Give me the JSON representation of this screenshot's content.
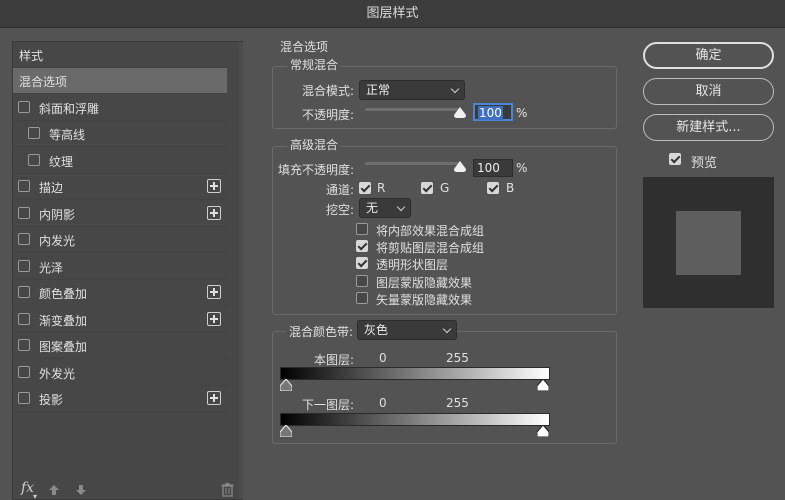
{
  "title": "图层样式",
  "sidebar": {
    "header": "样式",
    "items": [
      {
        "label": "混合选项",
        "checkbox": false,
        "checked": false,
        "selected": true,
        "indent": false,
        "plus": false
      },
      {
        "label": "斜面和浮雕",
        "checkbox": true,
        "checked": false,
        "selected": false,
        "indent": false,
        "plus": false
      },
      {
        "label": "等高线",
        "checkbox": true,
        "checked": false,
        "selected": false,
        "indent": true,
        "plus": false
      },
      {
        "label": "纹理",
        "checkbox": true,
        "checked": false,
        "selected": false,
        "indent": true,
        "plus": false
      },
      {
        "label": "描边",
        "checkbox": true,
        "checked": false,
        "selected": false,
        "indent": false,
        "plus": true
      },
      {
        "label": "内阴影",
        "checkbox": true,
        "checked": false,
        "selected": false,
        "indent": false,
        "plus": true
      },
      {
        "label": "内发光",
        "checkbox": true,
        "checked": false,
        "selected": false,
        "indent": false,
        "plus": false
      },
      {
        "label": "光泽",
        "checkbox": true,
        "checked": false,
        "selected": false,
        "indent": false,
        "plus": false
      },
      {
        "label": "颜色叠加",
        "checkbox": true,
        "checked": false,
        "selected": false,
        "indent": false,
        "plus": true
      },
      {
        "label": "渐变叠加",
        "checkbox": true,
        "checked": false,
        "selected": false,
        "indent": false,
        "plus": true
      },
      {
        "label": "图案叠加",
        "checkbox": true,
        "checked": false,
        "selected": false,
        "indent": false,
        "plus": false
      },
      {
        "label": "外发光",
        "checkbox": true,
        "checked": false,
        "selected": false,
        "indent": false,
        "plus": false
      },
      {
        "label": "投影",
        "checkbox": true,
        "checked": false,
        "selected": false,
        "indent": false,
        "plus": true
      }
    ],
    "footer_fx": "fx"
  },
  "blend": {
    "section_title": "混合选项",
    "general": {
      "title": "常规混合",
      "mode_label": "混合模式:",
      "mode_value": "正常",
      "opacity_label": "不透明度:",
      "opacity_value": "100",
      "opacity_unit": "%"
    },
    "advanced": {
      "title": "高级混合",
      "fill_label": "填充不透明度:",
      "fill_value": "100",
      "fill_unit": "%",
      "channels_label": "通道:",
      "channels": [
        {
          "name": "R",
          "checked": true
        },
        {
          "name": "G",
          "checked": true
        },
        {
          "name": "B",
          "checked": true
        }
      ],
      "knockout_label": "挖空:",
      "knockout_value": "无",
      "options": [
        {
          "label": "将内部效果混合成组",
          "checked": false
        },
        {
          "label": "将剪贴图层混合成组",
          "checked": true
        },
        {
          "label": "透明形状图层",
          "checked": true
        },
        {
          "label": "图层蒙版隐藏效果",
          "checked": false
        },
        {
          "label": "矢量蒙版隐藏效果",
          "checked": false
        }
      ]
    },
    "blend_if": {
      "label": "混合颜色带:",
      "value": "灰色",
      "this_layer_label": "本图层:",
      "this_layer_min": "0",
      "this_layer_max": "255",
      "under_layer_label": "下一图层:",
      "under_layer_min": "0",
      "under_layer_max": "255"
    }
  },
  "buttons": {
    "ok": "确定",
    "cancel": "取消",
    "new_style": "新建样式...",
    "preview_label": "预览",
    "preview_checked": true
  }
}
